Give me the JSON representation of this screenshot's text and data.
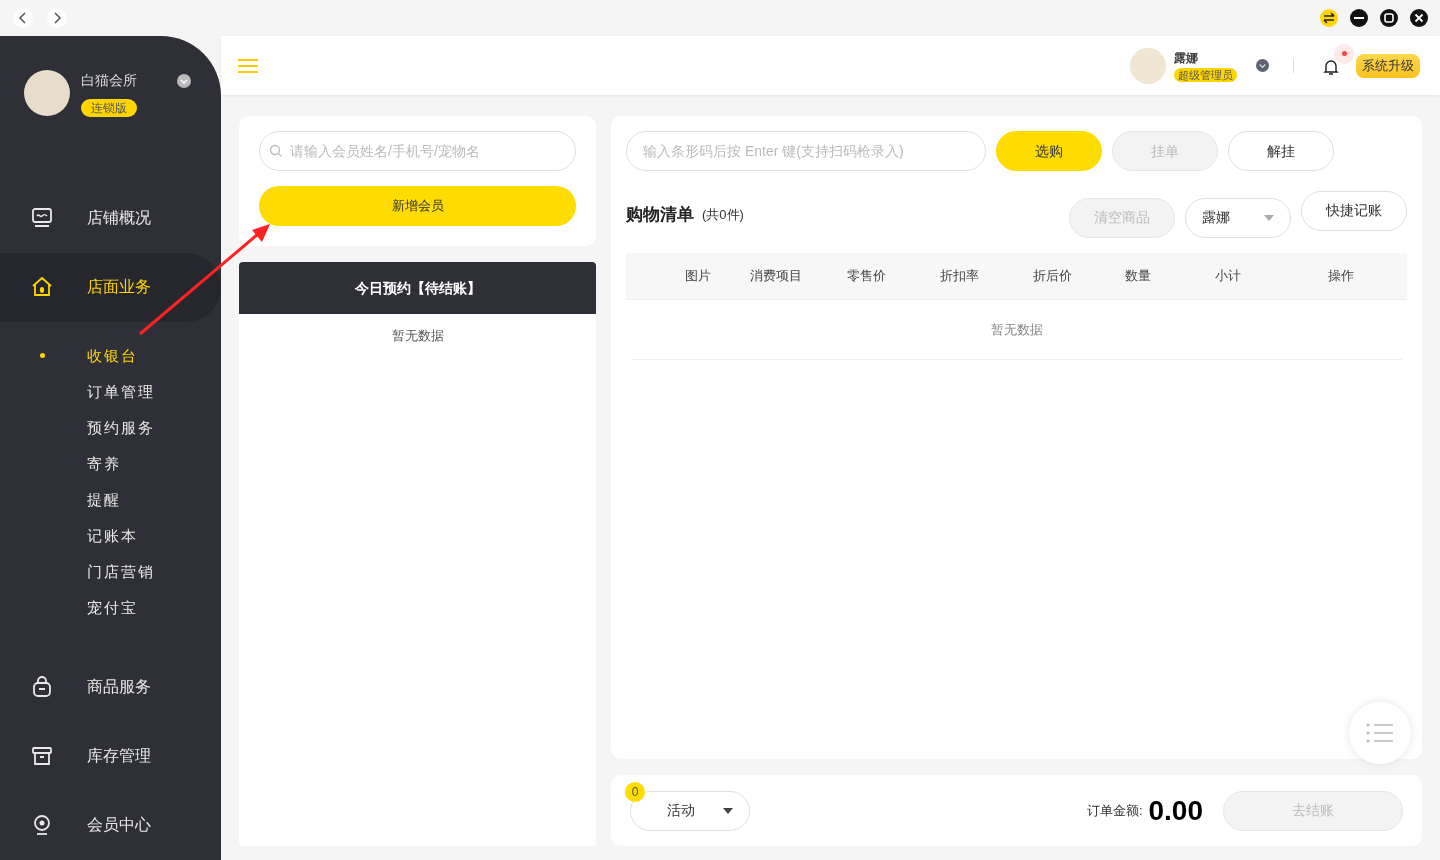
{
  "sidebar": {
    "store_name": "白猫会所",
    "edition_badge": "连锁版",
    "items": [
      {
        "label": "店铺概况",
        "selected": false
      },
      {
        "label": "店面业务",
        "selected": true,
        "expanded": true,
        "children": [
          {
            "label": "收银台",
            "selected": true
          },
          {
            "label": "订单管理",
            "selected": false
          },
          {
            "label": "预约服务",
            "selected": false
          },
          {
            "label": "寄养",
            "selected": false
          },
          {
            "label": "提醒",
            "selected": false
          },
          {
            "label": "记账本",
            "selected": false
          },
          {
            "label": "门店营销",
            "selected": false
          },
          {
            "label": "宠付宝",
            "selected": false
          }
        ]
      },
      {
        "label": "商品服务",
        "selected": false
      },
      {
        "label": "库存管理",
        "selected": false
      },
      {
        "label": "会员中心",
        "selected": false
      }
    ]
  },
  "header": {
    "user_name": "露娜",
    "role_badge": "超级管理员",
    "notification_unread": true,
    "upgrade_button": "系统升级"
  },
  "member_panel": {
    "search": {
      "placeholder": "请输入会员姓名/手机号/宠物名"
    },
    "add_button": "新增会员",
    "appointments_title": "今日预约【待结账】",
    "appointments_empty": "暂无数据"
  },
  "cart_panel": {
    "barcode": {
      "placeholder": "输入条形码后按 Enter 键(支持扫码枪录入)"
    },
    "buttons": [
      {
        "label": "选购",
        "kind": "primary",
        "disabled": false
      },
      {
        "label": "挂单",
        "kind": "plain",
        "disabled": true
      },
      {
        "label": "解挂",
        "kind": "plain",
        "disabled": false
      }
    ],
    "title": "购物清单",
    "count": "(共0件)",
    "clear_button": {
      "label": "清空商品",
      "disabled": true
    },
    "staff_select": "露娜",
    "quick_button": "快捷记账",
    "columns": [
      "图片",
      "消费项目",
      "零售价",
      "折扣率",
      "折后价",
      "数量",
      "小计",
      "操作"
    ],
    "empty": "暂无数据"
  },
  "footer": {
    "activity_count": "0",
    "activity_select": "活动",
    "total_label": "订单金额:",
    "total": "0.00",
    "checkout_button": {
      "label": "去结账",
      "disabled": true
    }
  }
}
